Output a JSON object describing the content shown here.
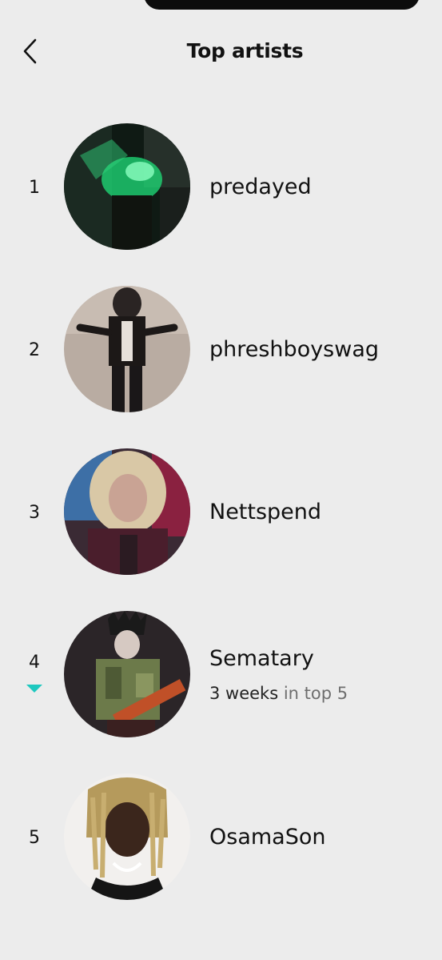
{
  "header": {
    "title": "Top artists",
    "back_icon": "chevron-left-icon"
  },
  "artists": [
    {
      "rank": "1",
      "name": "predayed",
      "avatar": "artist-photo"
    },
    {
      "rank": "2",
      "name": "phreshboyswag",
      "avatar": "artist-photo"
    },
    {
      "rank": "3",
      "name": "Nettspend",
      "avatar": "artist-photo"
    },
    {
      "rank": "4",
      "name": "Sematary",
      "avatar": "artist-photo",
      "change_icon": "down-arrow-icon",
      "streak_value": "3 weeks",
      "streak_suffix": "in top 5"
    },
    {
      "rank": "5",
      "name": "OsamaSon",
      "avatar": "artist-photo"
    }
  ],
  "colors": {
    "background": "#ececec",
    "accent_down": "#1ec8bf"
  }
}
